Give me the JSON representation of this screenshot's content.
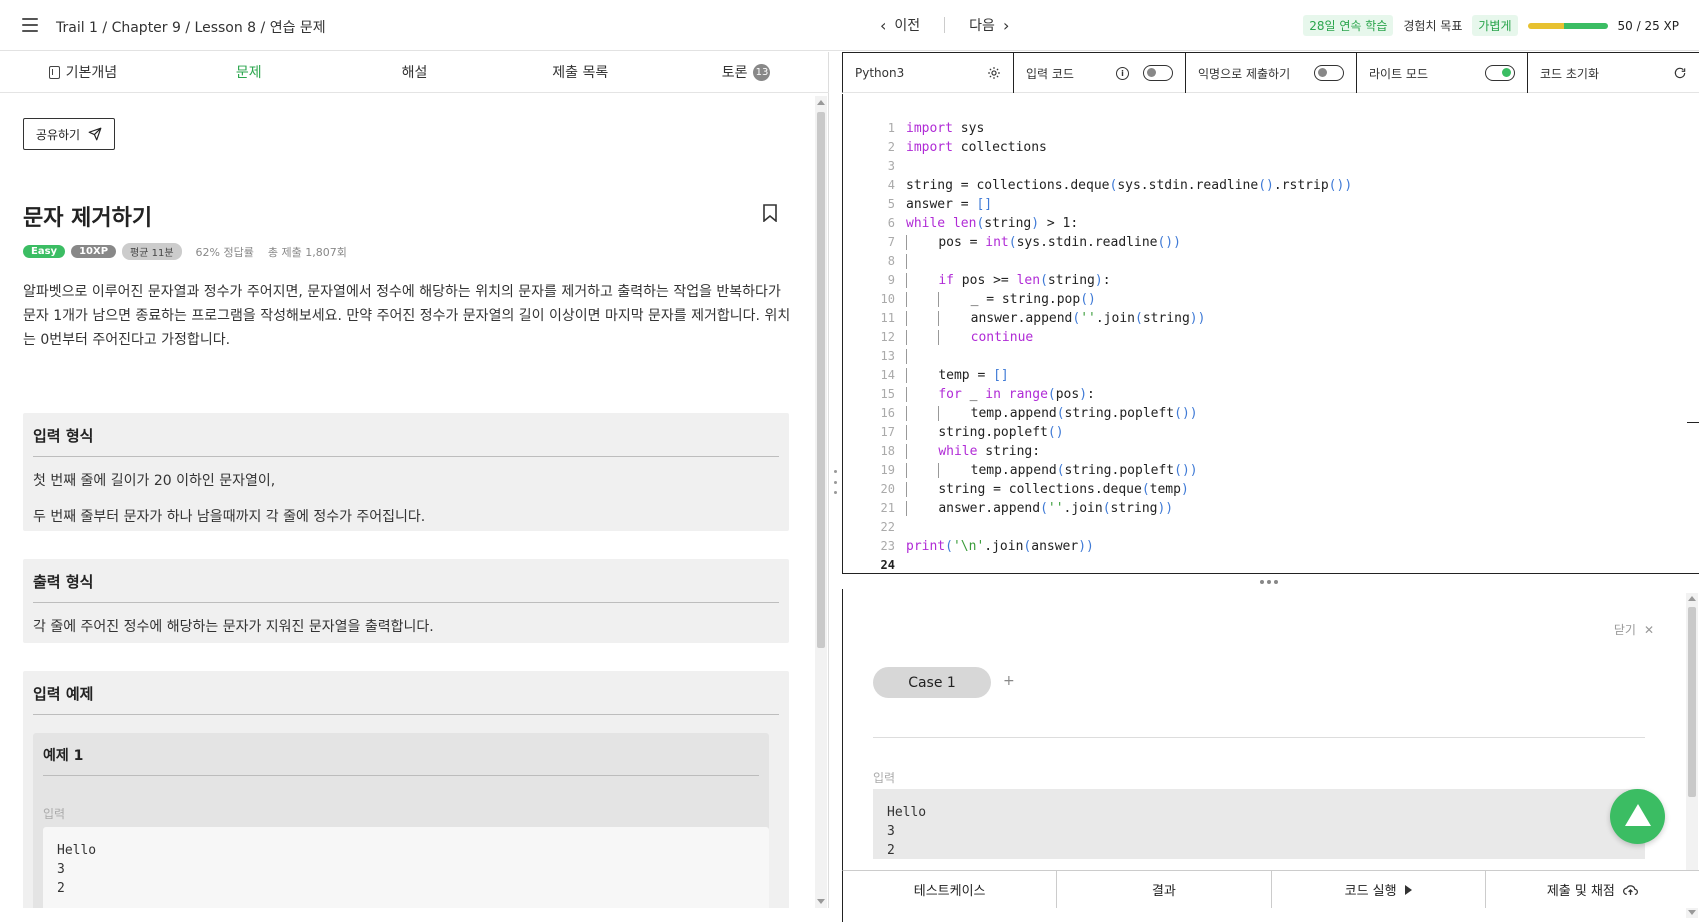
{
  "header": {
    "breadcrumb": "Trail 1 / Chapter 9 / Lesson 8 / 연습 문제",
    "prev_label": "이전",
    "next_label": "다음",
    "streak_badge": "28일 연속 학습",
    "xp_goal_label": "경험치 목표",
    "xp_goal_level": "가볍게",
    "xp_progress_text": "50 / 25 XP",
    "xp_progress_fraction": 1.0
  },
  "left_tabs": [
    {
      "label": "기본개념"
    },
    {
      "label": "문제"
    },
    {
      "label": "해설"
    },
    {
      "label": "제출 목록"
    },
    {
      "label": "토론",
      "count": "13"
    }
  ],
  "problem": {
    "share_label": "공유하기",
    "title": "문자 제거하기",
    "difficulty": "Easy",
    "xp": "10XP",
    "avg_time": "평균 11분",
    "accuracy": "62% 정답률",
    "submissions": "총 제출 1,807회",
    "description": "알파벳으로 이루어진 문자열과 정수가 주어지면, 문자열에서 정수에 해당하는 위치의 문자를 제거하고 출력하는 작업을 반복하다가 문자 1개가 남으면 종료하는 프로그램을 작성해보세요. 만약 주어진 정수가 문자열의 길이 이상이면 마지막 문자를 제거합니다. 위치는 0번부터 주어진다고 가정합니다.",
    "input_format_title": "입력 형식",
    "input_format_lines": [
      "첫 번째 줄에 길이가 20 이하인 문자열이,",
      "두 번째 줄부터 문자가 하나 남을때까지 각 줄에 정수가 주어집니다."
    ],
    "output_format_title": "출력 형식",
    "output_format_line": "각 줄에 주어진 정수에 해당하는 문자가 지워진 문자열을 출력합니다.",
    "input_example_title": "입력 예제",
    "example1_title": "예제 1",
    "example1_input_label": "입력",
    "example1_input": "Hello\n3\n2"
  },
  "editor_toolbar": {
    "language": "Python3",
    "input_code_label": "입력 코드",
    "anonymous_label": "익명으로 제출하기",
    "light_mode_label": "라이트 모드",
    "reset_label": "코드 초기화"
  },
  "editor": {
    "line_numbers": [
      "1",
      "2",
      "3",
      "4",
      "5",
      "6",
      "7",
      "8",
      "9",
      "10",
      "11",
      "12",
      "13",
      "14",
      "15",
      "16",
      "17",
      "18",
      "19",
      "20",
      "21",
      "22",
      "23",
      "24"
    ],
    "current_line": "24"
  },
  "testcase_panel": {
    "close_label": "닫기",
    "case_label": "Case 1",
    "add_label": "+",
    "input_label": "입력",
    "input_value": "Hello\n3\n2"
  },
  "bottom_bar": {
    "testcase_label": "테스트케이스",
    "result_label": "결과",
    "run_label": "코드 실행",
    "submit_label": "제출 및 채점"
  },
  "colors": {
    "accent_green": "#3bbd63",
    "keyword_purple": "#b02bd6",
    "string_green": "#3a9c3a",
    "paren_blue": "#3f7ad6"
  }
}
